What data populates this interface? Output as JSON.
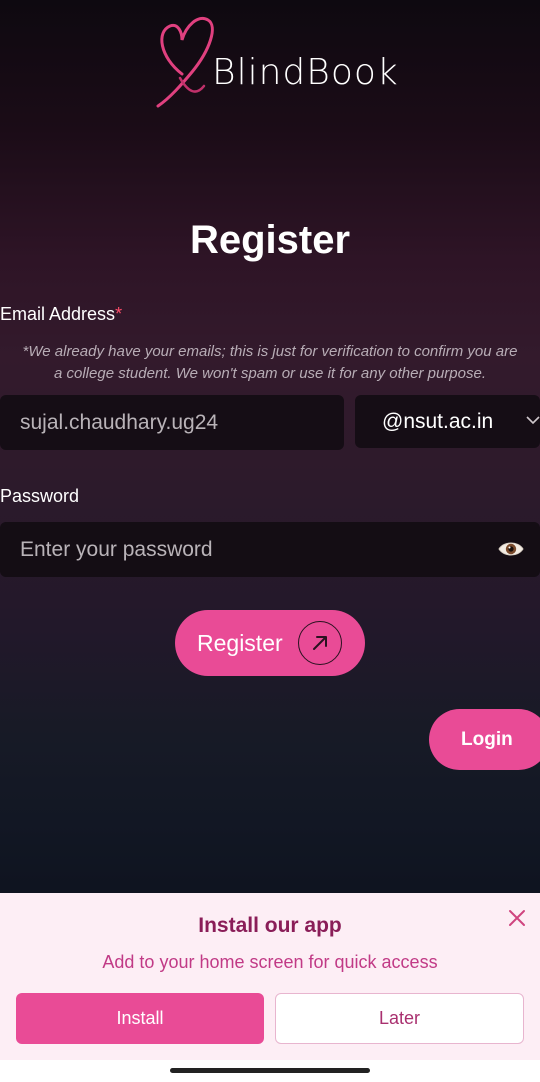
{
  "app": {
    "name": "BlindBook"
  },
  "form": {
    "title": "Register",
    "email_label": "Email Address",
    "required_mark": "*",
    "email_note": "*We already have your emails; this is just for verification to confirm you are a college student. We won't spam or use it for any other purpose.",
    "email_value": "sujal.chaudhary.ug24",
    "domain_selected": "@nsut.ac.in",
    "password_label": "Password",
    "password_placeholder": "Enter your password",
    "register_label": "Register",
    "login_label": "Login"
  },
  "install_prompt": {
    "title": "Install our app",
    "subtitle": "Add to your home screen for quick access",
    "install_label": "Install",
    "later_label": "Later"
  },
  "colors": {
    "accent": "#e94b96",
    "install_title": "#8a1d58",
    "install_sub": "#c13a86",
    "panel_bg": "#fdeef5"
  },
  "icons": {
    "logo": "heart-logo-icon",
    "domain_dropdown": "chevron-down-icon",
    "password_toggle": "eye-icon",
    "register_arrow": "arrow-up-right-icon",
    "dismiss": "close-icon"
  }
}
